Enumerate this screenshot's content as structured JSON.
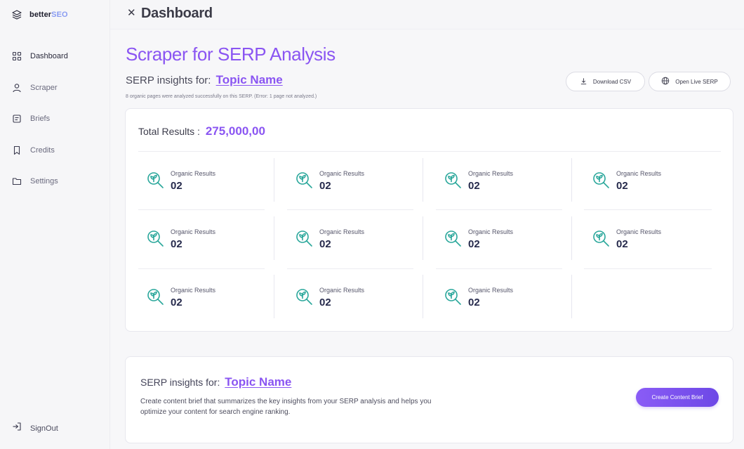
{
  "sidebar": {
    "brand": {
      "prefix": "better",
      "suffix": "SEO"
    },
    "items": [
      {
        "label": "Dashboard",
        "icon": "grid-icon"
      },
      {
        "label": "Scraper",
        "icon": "user-icon"
      },
      {
        "label": "Briefs",
        "icon": "note-icon"
      },
      {
        "label": "Credits",
        "icon": "bookmark-icon"
      },
      {
        "label": "Settings",
        "icon": "folder-icon"
      }
    ],
    "signout": "SignOut"
  },
  "header": {
    "title": "Dashboard",
    "close_icon": "close-icon"
  },
  "main": {
    "title": "Scraper for SERP Analysis",
    "insights_prefix": "SERP insights for:",
    "topic": "Topic Name",
    "note": "8 organic pages were analyzed successfully on this SERP. (Error: 1 page not analyzed.)",
    "buttons": {
      "download_csv": "Download CSV",
      "open_live_serp": "Open Live SERP"
    }
  },
  "results": {
    "total_label": "Total Results :",
    "total_value": "275,000,00",
    "stats": [
      {
        "label": "Organic Results",
        "value": "02"
      },
      {
        "label": "Organic Results",
        "value": "02"
      },
      {
        "label": "Organic Results",
        "value": "02"
      },
      {
        "label": "Organic Results",
        "value": "02"
      },
      {
        "label": "Organic Results",
        "value": "02"
      },
      {
        "label": "Organic Results",
        "value": "02"
      },
      {
        "label": "Organic Results",
        "value": "02"
      },
      {
        "label": "Organic Results",
        "value": "02"
      },
      {
        "label": "Organic Results",
        "value": "02"
      },
      {
        "label": "Organic Results",
        "value": "02"
      },
      {
        "label": "Organic Results",
        "value": "02"
      }
    ]
  },
  "brief": {
    "prefix": "SERP insights for:",
    "topic": "Topic Name",
    "description": "Create content brief that summarizes the key insights from your SERP analysis and helps you optimize your content for search engine ranking.",
    "button": "Create Content Brief"
  },
  "colors": {
    "accent": "#8a55f2",
    "teal": "#2aa79b",
    "navy": "#262a4c"
  }
}
